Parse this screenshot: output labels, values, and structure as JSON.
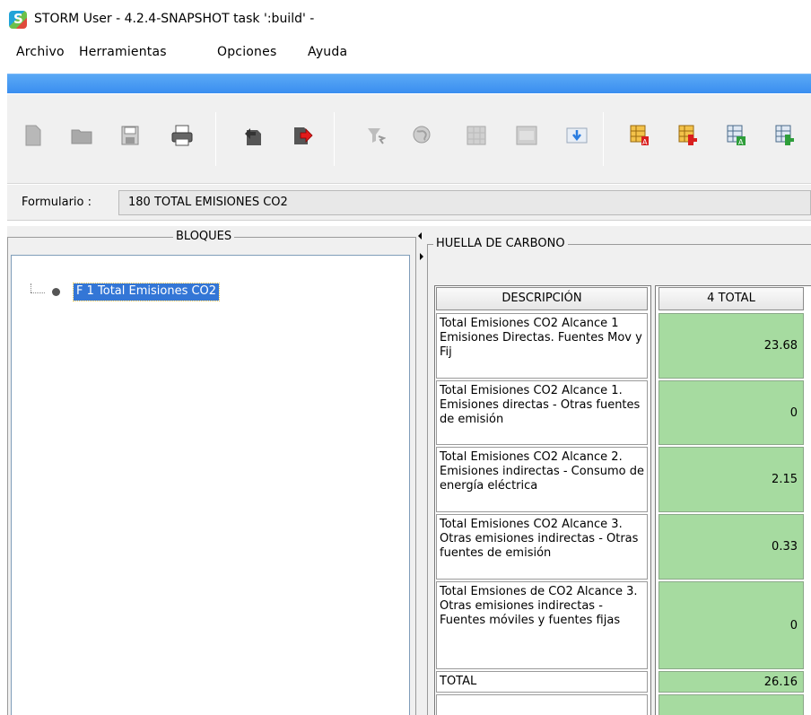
{
  "window": {
    "title": "STORM User - 4.2.4-SNAPSHOT  task ':build' -"
  },
  "menu": {
    "items": [
      "Archivo",
      "Herramientas",
      "Opciones",
      "Ayuda"
    ]
  },
  "toolbar": {
    "buttons": [
      {
        "name": "new-document-icon"
      },
      {
        "name": "open-folder-icon"
      },
      {
        "name": "save-icon"
      },
      {
        "name": "print-icon"
      },
      {
        "name": "import-icon"
      },
      {
        "name": "export-icon"
      },
      {
        "name": "filter-icon"
      },
      {
        "name": "globe-icon"
      },
      {
        "name": "grid-icon"
      },
      {
        "name": "form-icon"
      },
      {
        "name": "download-icon"
      },
      {
        "name": "table-red-a-icon"
      },
      {
        "name": "table-red-b-icon"
      },
      {
        "name": "table-green-a-icon"
      },
      {
        "name": "table-green-b-icon"
      }
    ]
  },
  "form": {
    "label": "Formulario :",
    "value": "180 TOTAL EMISIONES CO2"
  },
  "bloques": {
    "title": "BLOQUES",
    "items": [
      {
        "label": "F 1 Total Emisiones CO2",
        "selected": true
      }
    ]
  },
  "huella": {
    "title": "HUELLA DE CARBONO",
    "headers": {
      "description": "DESCRIPCIÓN",
      "value": "4 TOTAL"
    },
    "rows": [
      {
        "description": "Total Emisiones CO2 Alcance 1 Emisiones Directas. Fuentes Mov y Fij",
        "value": "23.68"
      },
      {
        "description": "Total Emisiones CO2 Alcance 1. Emisiones directas - Otras fuentes de emisión",
        "value": "0"
      },
      {
        "description": "Total Emisiones CO2 Alcance 2. Emisiones indirectas - Consumo de energía eléctrica",
        "value": "2.15"
      },
      {
        "description": "Total Emisiones CO2 Alcance 3. Otras emisiones indirectas - Otras fuentes de emisión",
        "value": "0.33"
      },
      {
        "description": "Total Emsiones de CO2 Alcance 3. Otras emisiones indirectas - Fuentes móviles y fuentes fijas",
        "value": "0"
      }
    ],
    "total": {
      "description": "TOTAL",
      "value": "26.16"
    }
  },
  "colors": {
    "accent_bar": "#3a8ef0",
    "value_cell": "#a6dba0",
    "selection": "#3376d6"
  }
}
